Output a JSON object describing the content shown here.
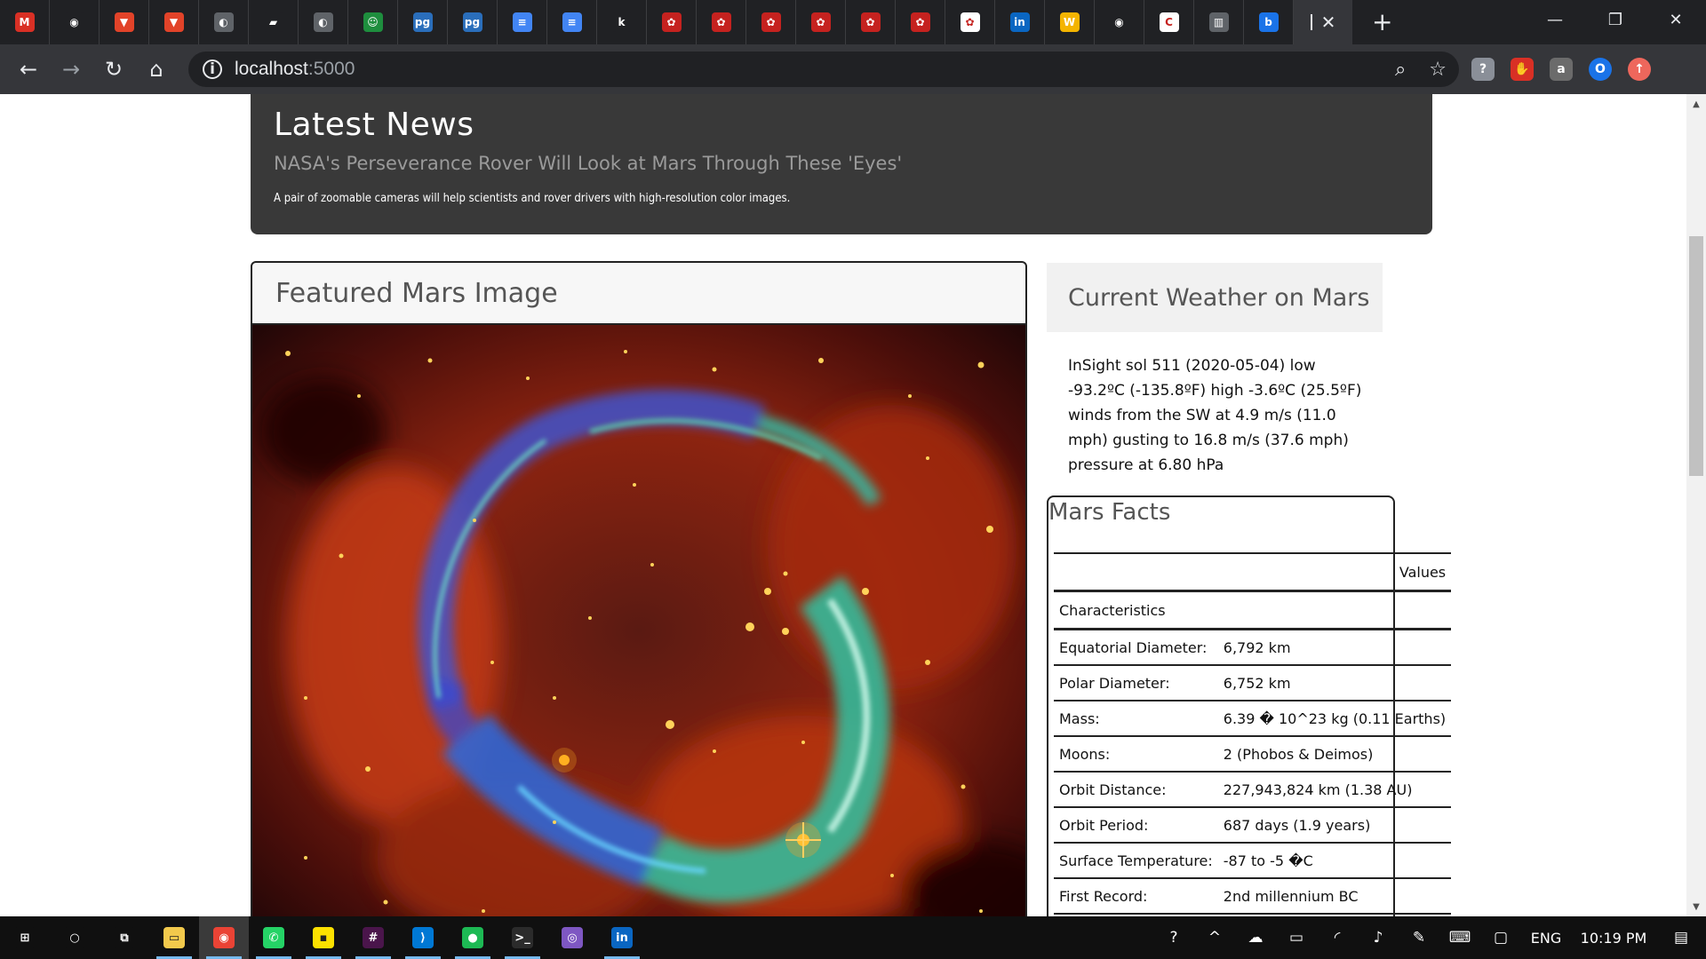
{
  "browser": {
    "tabs": [
      {
        "icon": "gmail-icon",
        "letter": "M",
        "color": "#d93025"
      },
      {
        "icon": "github-icon",
        "letter": "◉",
        "color": "#202124"
      },
      {
        "icon": "gitlab-icon",
        "letter": "▼",
        "color": "#e24329"
      },
      {
        "icon": "gitlab-icon",
        "letter": "▼",
        "color": "#e24329"
      },
      {
        "icon": "globe-icon",
        "letter": "◐",
        "color": "#5f6368"
      },
      {
        "icon": "book-icon",
        "letter": "▰",
        "color": "#202124"
      },
      {
        "icon": "globe-icon",
        "letter": "◐",
        "color": "#5f6368"
      },
      {
        "icon": "trello-like-icon",
        "letter": "☺",
        "color": "#1e8e3e"
      },
      {
        "icon": "pg-icon",
        "letter": "pg",
        "color": "#2a6ebb"
      },
      {
        "icon": "pg-icon",
        "letter": "pg",
        "color": "#2a6ebb"
      },
      {
        "icon": "google-docs-icon",
        "letter": "≡",
        "color": "#4285f4"
      },
      {
        "icon": "google-docs-icon",
        "letter": "≡",
        "color": "#4285f4"
      },
      {
        "icon": "k-icon",
        "letter": "k",
        "color": "#202124"
      },
      {
        "icon": "flower-icon",
        "letter": "✿",
        "color": "#c5221f"
      },
      {
        "icon": "flower-icon",
        "letter": "✿",
        "color": "#c5221f"
      },
      {
        "icon": "flower-icon",
        "letter": "✿",
        "color": "#c5221f"
      },
      {
        "icon": "flower-icon",
        "letter": "✿",
        "color": "#c5221f"
      },
      {
        "icon": "flower-icon",
        "letter": "✿",
        "color": "#c5221f"
      },
      {
        "icon": "flower-icon",
        "letter": "✿",
        "color": "#c5221f"
      },
      {
        "icon": "flower-box-icon",
        "letter": "✿",
        "color": "#ffffff"
      },
      {
        "icon": "linkedin-icon",
        "letter": "in",
        "color": "#0a66c2"
      },
      {
        "icon": "headphones-icon",
        "letter": "W",
        "color": "#f4b400"
      },
      {
        "icon": "github-icon",
        "letter": "◉",
        "color": "#202124"
      },
      {
        "icon": "c-icon",
        "letter": "C",
        "color": "#ffffff"
      },
      {
        "icon": "reader-icon",
        "letter": "▥",
        "color": "#5f6368"
      },
      {
        "icon": "b-icon",
        "letter": "b",
        "color": "#1a73e8"
      }
    ],
    "window_controls": {
      "minimize": "—",
      "restore": "❐",
      "close": "✕"
    },
    "new_tab": "+",
    "url_host": "localhost",
    "url_port": ":5000",
    "extensions": [
      {
        "icon": "shield-icon",
        "letter": "?",
        "color": "#8a8f98"
      },
      {
        "icon": "hand-stop-icon",
        "letter": "✋",
        "color": "#d93025"
      },
      {
        "icon": "bag-icon",
        "letter": "a",
        "color": "#6b6b6b"
      },
      {
        "icon": "profile-icon",
        "letter": "O",
        "color": "#1a73e8"
      },
      {
        "icon": "update-icon",
        "letter": "↑",
        "color": "#ee675c"
      }
    ]
  },
  "news": {
    "section_title": "Latest News",
    "headline": "NASA's Perseverance Rover Will Look at Mars Through These 'Eyes'",
    "teaser": "A pair of zoomable cameras will help scientists and rover drivers with high-resolution color images."
  },
  "featured": {
    "title": "Featured Mars Image"
  },
  "weather": {
    "title": "Current Weather on Mars",
    "text": "InSight sol 511 (2020-05-04) low -93.2ºC (-135.8ºF) high -3.6ºC (25.5ºF) winds from the SW at 4.9 m/s (11.0 mph) gusting to 16.8 m/s (37.6 mph) pressure at 6.80 hPa"
  },
  "facts": {
    "title": "Mars Facts",
    "header_values": "Values",
    "header_row": "Characteristics",
    "rows": [
      {
        "label": "Equatorial Diameter:",
        "value": "6,792 km"
      },
      {
        "label": "Polar Diameter:",
        "value": "6,752 km"
      },
      {
        "label": "Mass:",
        "value": "6.39 � 10^23 kg (0.11 Earths)"
      },
      {
        "label": "Moons:",
        "value": "2 (Phobos & Deimos)"
      },
      {
        "label": "Orbit Distance:",
        "value": "227,943,824 km (1.38 AU)"
      },
      {
        "label": "Orbit Period:",
        "value": "687 days (1.9 years)"
      },
      {
        "label": "Surface Temperature:",
        "value": "-87 to -5 �C"
      },
      {
        "label": "First Record:",
        "value": "2nd millennium BC"
      }
    ]
  },
  "taskbar": {
    "apps": [
      {
        "icon": "windows-start-icon",
        "letter": "⊞",
        "color": "#101010"
      },
      {
        "icon": "cortana-icon",
        "letter": "○",
        "color": "#101010"
      },
      {
        "icon": "task-view-icon",
        "letter": "⧉",
        "color": "#101010"
      },
      {
        "icon": "file-explorer-icon",
        "letter": "▭",
        "color": "#f2c94c"
      },
      {
        "icon": "chrome-icon",
        "letter": "◉",
        "color": "#ea4335"
      },
      {
        "icon": "whatsapp-icon",
        "letter": "✆",
        "color": "#25d366"
      },
      {
        "icon": "sticky-notes-icon",
        "letter": "▪",
        "color": "#fce100"
      },
      {
        "icon": "slack-icon",
        "letter": "#",
        "color": "#4a154b"
      },
      {
        "icon": "vscode-icon",
        "letter": "⟩",
        "color": "#0078d4"
      },
      {
        "icon": "o-app-icon",
        "letter": "●",
        "color": "#1db954"
      },
      {
        "icon": "terminal-icon",
        "letter": ">_",
        "color": "#2b2b2b"
      },
      {
        "icon": "purple-app-icon",
        "letter": "◎",
        "color": "#7e57c2"
      },
      {
        "icon": "linkedin-icon",
        "letter": "in",
        "color": "#0a66c2"
      }
    ],
    "language": "ENG",
    "time": "10:19 PM"
  }
}
